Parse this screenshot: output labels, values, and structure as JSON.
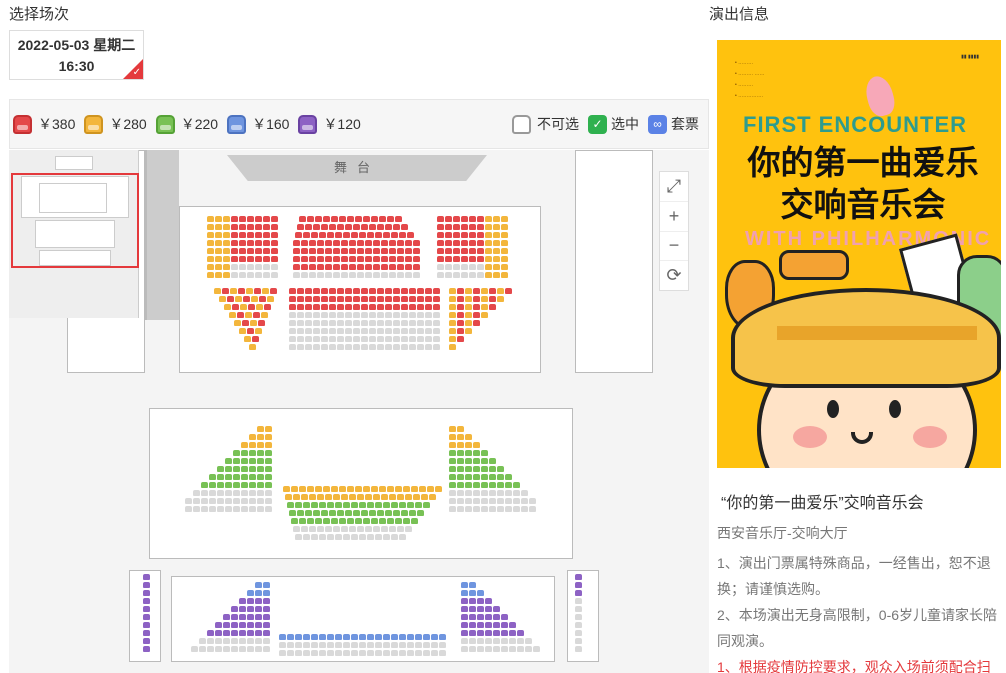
{
  "left_title": "选择场次",
  "right_title": "演出信息",
  "session": {
    "date_line": "2022-05-03 星期二",
    "time": "16:30"
  },
  "legend": {
    "prices": [
      {
        "label": "￥380",
        "color": "#e4484a"
      },
      {
        "label": "￥280",
        "color": "#f3b63c"
      },
      {
        "label": "￥220",
        "color": "#78c155"
      },
      {
        "label": "￥160",
        "color": "#6f95df"
      },
      {
        "label": "￥120",
        "color": "#8d62c4"
      }
    ],
    "unavailable": "不可选",
    "selected": "选中",
    "package": "套票"
  },
  "hall": {
    "stage_label": "舞台"
  },
  "colors": {
    "unavailable": "#d9d9d9",
    "selected": "#2fb14f",
    "package": "#5b82e6"
  },
  "icons": [
    "expand-icon",
    "zoom-in-icon",
    "zoom-out-icon",
    "refresh-icon"
  ],
  "poster": {
    "english_title": "FIRST ENCOUNTER",
    "chinese_title": "你的第一曲爱乐交响音乐会",
    "english_subtitle": "WITH PHILHARMONIC"
  },
  "show": {
    "title": "“你的第一曲爱乐”交响音乐会",
    "venue": "西安音乐厅-交响大厅",
    "note1": "1、演出门票属特殊商品，一经售出，恕不退换；请谨慎选购。",
    "note2": "2、本场演出无身高限制，0-6岁儿童请家长陪同观演。",
    "note3": "1、根据疫情防控要求，观众入场前须配合扫"
  }
}
